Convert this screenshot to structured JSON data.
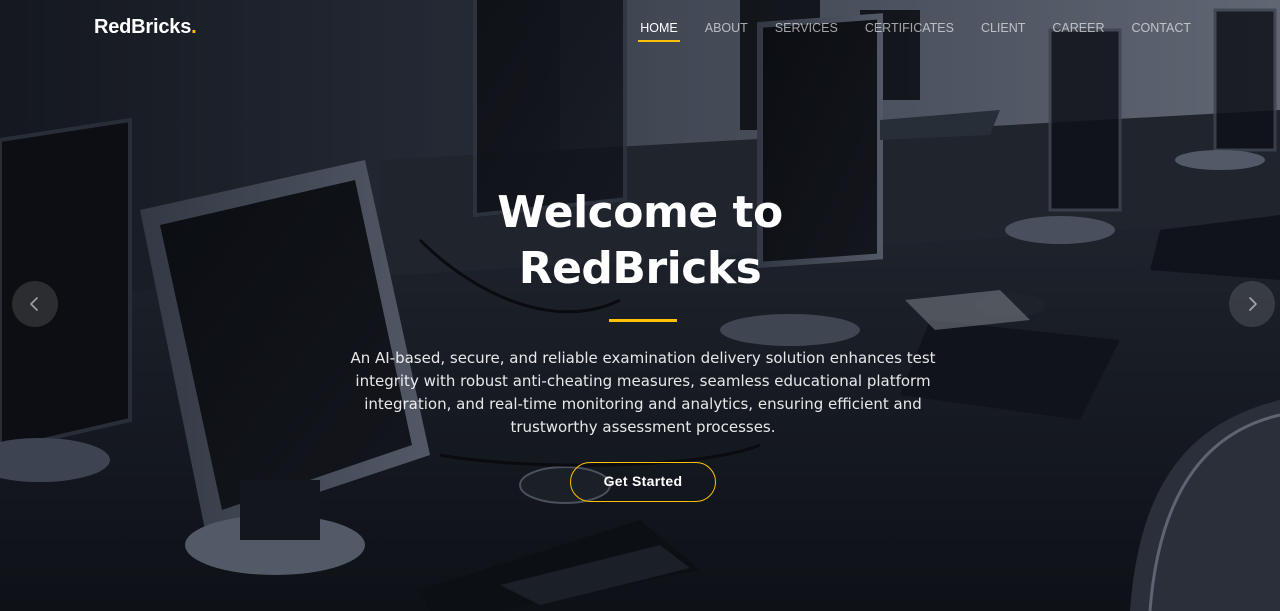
{
  "header": {
    "logo_text": "RedBricks",
    "logo_dot": ".",
    "nav": [
      {
        "label": "HOME",
        "active": true
      },
      {
        "label": "ABOUT",
        "active": false
      },
      {
        "label": "SERVICES",
        "active": false
      },
      {
        "label": "CERTIFICATES",
        "active": false
      },
      {
        "label": "CLIENT",
        "active": false
      },
      {
        "label": "CAREER",
        "active": false
      },
      {
        "label": "CONTACT",
        "active": false
      }
    ]
  },
  "hero": {
    "title_line1": "Welcome to",
    "title_line2": "RedBricks",
    "description": "An AI-based, secure, and reliable examination delivery solution enhances test integrity with robust anti-cheating measures, seamless educational platform integration, and real-time monitoring and analytics, ensuring efficient and trustworthy assessment processes.",
    "cta_label": "Get Started",
    "background_icon": "computer-lab-photo"
  },
  "carousel": {
    "prev_icon": "chevron-left-icon",
    "next_icon": "chevron-right-icon"
  },
  "colors": {
    "accent": "#ffc107",
    "text": "#ffffff",
    "nav_inactive": "#a8aaad"
  }
}
